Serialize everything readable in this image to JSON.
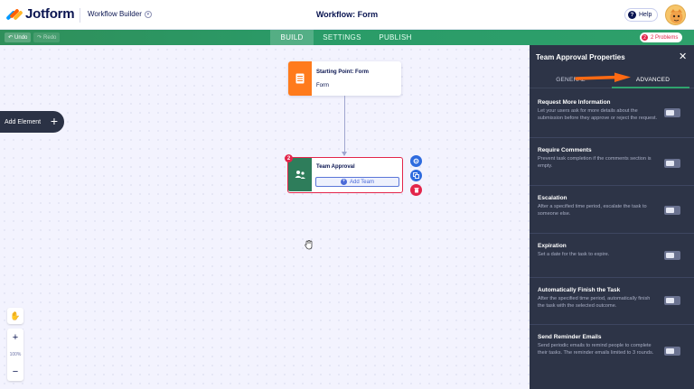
{
  "header": {
    "brand": "Jotform",
    "builder_label": "Workflow Builder",
    "title": "Workflow: Form",
    "help_label": "Help"
  },
  "toolbar": {
    "undo_label": "Undo",
    "redo_label": "Redo",
    "tabs": [
      {
        "label": "BUILD",
        "active": true
      },
      {
        "label": "SETTINGS",
        "active": false
      },
      {
        "label": "PUBLISH",
        "active": false
      }
    ],
    "problems_count": "2",
    "problems_label": "2 Problems"
  },
  "canvas": {
    "add_element_label": "Add Element",
    "start_node": {
      "title": "Starting Point: Form",
      "subtitle": "Form"
    },
    "team_node": {
      "title": "Team Approval",
      "add_team_label": "Add Team",
      "error_count": "2"
    },
    "zoom_level": "100%"
  },
  "panel": {
    "title": "Team Approval Properties",
    "tabs": [
      {
        "label": "GENERAL",
        "active": false
      },
      {
        "label": "ADVANCED",
        "active": true
      }
    ],
    "properties": [
      {
        "title": "Request More Information",
        "desc": "Let your users ask for more details about the submission before they approve or reject the request.",
        "enabled": false
      },
      {
        "title": "Require Comments",
        "desc": "Prevent task completion if the comments section is empty.",
        "enabled": false
      },
      {
        "title": "Escalation",
        "desc": "After a specified time period, escalate the task to someone else.",
        "enabled": false
      },
      {
        "title": "Expiration",
        "desc": "Set a date for the task to expire.",
        "enabled": false
      },
      {
        "title": "Automatically Finish the Task",
        "desc": "After the specified time period, automatically finish the task with the selected outcome.",
        "enabled": false
      },
      {
        "title": "Send Reminder Emails",
        "desc": "Send periodic emails to remind people to complete their tasks. The reminder emails limited to 3 rounds.",
        "enabled": false
      }
    ]
  },
  "colors": {
    "accent_green": "#2a9b68",
    "error_red": "#e3254a",
    "start_orange": "#ff7b1c",
    "panel_bg": "#2d3447",
    "annotation_arrow": "#ff6a13"
  }
}
